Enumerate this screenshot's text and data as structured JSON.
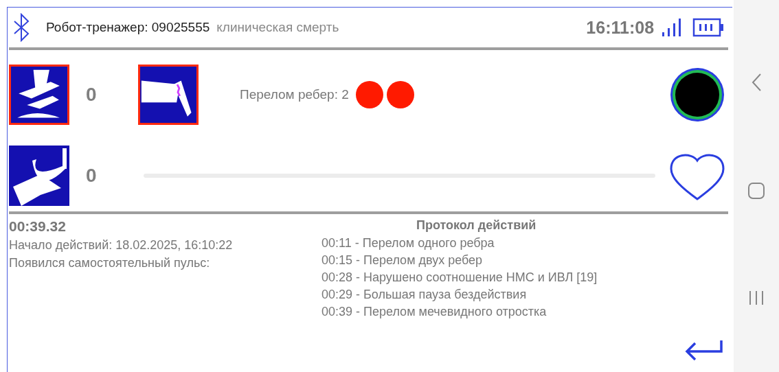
{
  "header": {
    "device": "Робот-тренажер: 09025555",
    "mode": "клиническая смерть",
    "time": "16:11:08"
  },
  "compression": {
    "tile": {
      "alert": true
    },
    "count": "0"
  },
  "rib_break": {
    "tile": {
      "alert": true
    },
    "label": "Перелом ребер: 2",
    "dots": [
      {
        "color": "#ff1a00"
      },
      {
        "color": "#ff1a00"
      }
    ]
  },
  "ventilation": {
    "tile": {
      "alert": false
    },
    "count": "0"
  },
  "timer": "00:39.32",
  "start": "Начало действий: 18.02.2025, 16:10:22",
  "pulse": "Появился самостоятельный пульс:",
  "protocol": {
    "title": "Протокол действий",
    "entries": [
      "00:11 - Перелом одного ребра",
      "00:15 - Перелом двух ребер",
      "00:28 - Нарушено соотношение НМС и ИВЛ [19]",
      "00:29 - Большая пауза бездействия",
      "00:39 - Перелом мечевидного отростка"
    ]
  }
}
